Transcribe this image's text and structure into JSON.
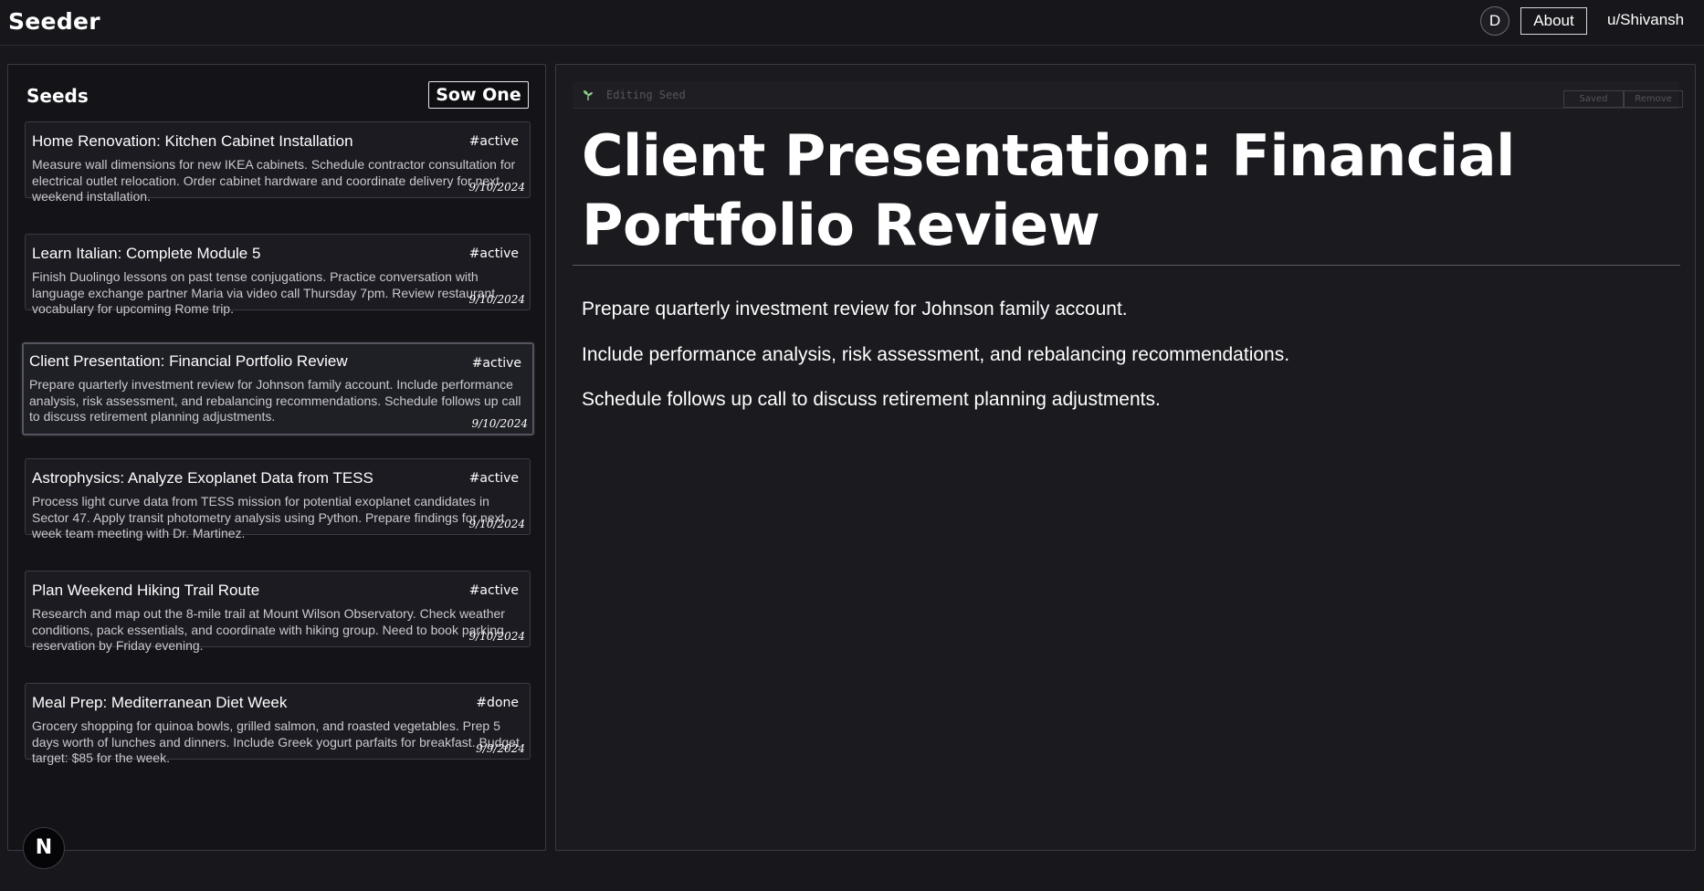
{
  "app": {
    "brand": "Seeder"
  },
  "header": {
    "avatar_initial": "D",
    "about_label": "About",
    "username": "u/Shivansh"
  },
  "sidebar": {
    "title": "Seeds",
    "sow_label": "Sow One",
    "items": [
      {
        "title": "Home Renovation: Kitchen Cabinet Installation",
        "tag": "#active",
        "description": "Measure wall dimensions for new IKEA cabinets. Schedule contractor consultation for electrical outlet relocation. Order cabinet hardware and coordinate delivery for next weekend installation.",
        "date": "9/10/2024"
      },
      {
        "title": "Learn Italian: Complete Module 5",
        "tag": "#active",
        "description": "Finish Duolingo lessons on past tense conjugations. Practice conversation with language exchange partner Maria via video call Thursday 7pm. Review restaurant vocabulary for upcoming Rome trip.",
        "date": "9/10/2024"
      },
      {
        "title": "Client Presentation: Financial Portfolio Review",
        "tag": "#active",
        "description": "Prepare quarterly investment review for Johnson family account. Include performance analysis, risk assessment, and rebalancing recommendations. Schedule follows up call to discuss retirement planning adjustments.",
        "date": "9/10/2024"
      },
      {
        "title": "Astrophysics: Analyze Exoplanet Data from TESS",
        "tag": "#active",
        "description": "Process light curve data from TESS mission for potential exoplanet candidates in Sector 47. Apply transit photometry analysis using Python. Prepare findings for next week team meeting with Dr. Martinez.",
        "date": "9/10/2024"
      },
      {
        "title": "Plan Weekend Hiking Trail Route",
        "tag": "#active",
        "description": "Research and map out the 8-mile trail at Mount Wilson Observatory. Check weather conditions, pack essentials, and coordinate with hiking group. Need to book parking reservation by Friday evening.",
        "date": "9/10/2024"
      },
      {
        "title": "Meal Prep: Mediterranean Diet Week",
        "tag": "#done",
        "description": "Grocery shopping for quinoa bowls, grilled salmon, and roasted vegetables. Prep 5 days worth of lunches and dinners. Include Greek yogurt parfaits for breakfast. Budget target: $85 for the week.",
        "date": "9/9/2024"
      }
    ],
    "next_badge": "N"
  },
  "editor": {
    "status_label": "Editing Seed",
    "saved_label": "Saved",
    "remove_label": "Remove",
    "title": "Client Presentation: Financial Portfolio Review",
    "paragraphs": [
      "Prepare quarterly investment review for Johnson family account.",
      "Include performance analysis, risk assessment, and rebalancing recommendations.",
      "Schedule follows up call to discuss retirement planning adjustments."
    ]
  },
  "colors": {
    "background": "#17171c",
    "panel": "#131318",
    "accent_leaf": "#8fd18a"
  }
}
